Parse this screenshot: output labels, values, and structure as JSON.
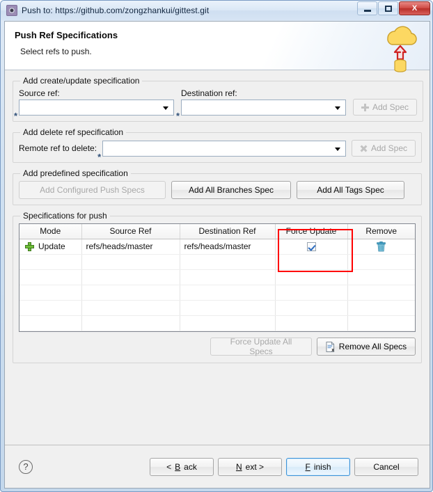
{
  "window": {
    "title": "Push to: https://github.com/zongzhankui/gittest.git",
    "icon": "gear-icon",
    "buttons": {
      "minimize": "minimize-icon",
      "maximize": "maximize-icon",
      "close": "X"
    }
  },
  "banner": {
    "title": "Push Ref Specifications",
    "subtitle": "Select refs to push.",
    "art": "cloud-push-icon"
  },
  "groups": {
    "create_update": {
      "legend": "Add create/update specification",
      "source_label": "Source ref:",
      "source_value": "",
      "destination_label": "Destination ref:",
      "destination_value": "",
      "required_marker": "*",
      "add_button": "Add Spec",
      "add_button_icon": "plus-icon",
      "add_button_enabled": false
    },
    "delete_ref": {
      "legend": "Add delete ref specification",
      "remote_label": "Remote ref to delete:",
      "remote_value": "",
      "required_marker": "*",
      "add_button": "Add Spec",
      "add_button_icon": "x-icon",
      "add_button_enabled": false
    },
    "predefined": {
      "legend": "Add predefined specification",
      "buttons": [
        {
          "label": "Add Configured Push Specs",
          "enabled": false
        },
        {
          "label": "Add All Branches Spec",
          "enabled": true
        },
        {
          "label": "Add All Tags Spec",
          "enabled": true
        }
      ]
    },
    "specifications": {
      "legend": "Specifications for push",
      "columns": [
        "Mode",
        "Source Ref",
        "Destination Ref",
        "Force Update",
        "Remove"
      ],
      "rows": [
        {
          "mode_icon": "green-plus-icon",
          "mode": "Update",
          "source_ref": "refs/heads/master",
          "destination_ref": "refs/heads/master",
          "force_update": true,
          "remove_icon": "trash-icon"
        }
      ],
      "empty_row_count": 6,
      "highlight_color": "#ff0000",
      "highlighted_column": "Force Update",
      "actions": [
        {
          "label": "Force Update All Specs",
          "enabled": false,
          "icon": null
        },
        {
          "label": "Remove All Specs",
          "enabled": true,
          "icon": "document-delete-icon"
        }
      ]
    }
  },
  "footer": {
    "help_icon": "?",
    "buttons": [
      {
        "label": "< Back",
        "mnemonic": "B",
        "default": false
      },
      {
        "label": "Next >",
        "mnemonic": "N",
        "default": false
      },
      {
        "label": "Finish",
        "mnemonic": "F",
        "default": true
      },
      {
        "label": "Cancel",
        "mnemonic": "",
        "default": false
      }
    ]
  }
}
